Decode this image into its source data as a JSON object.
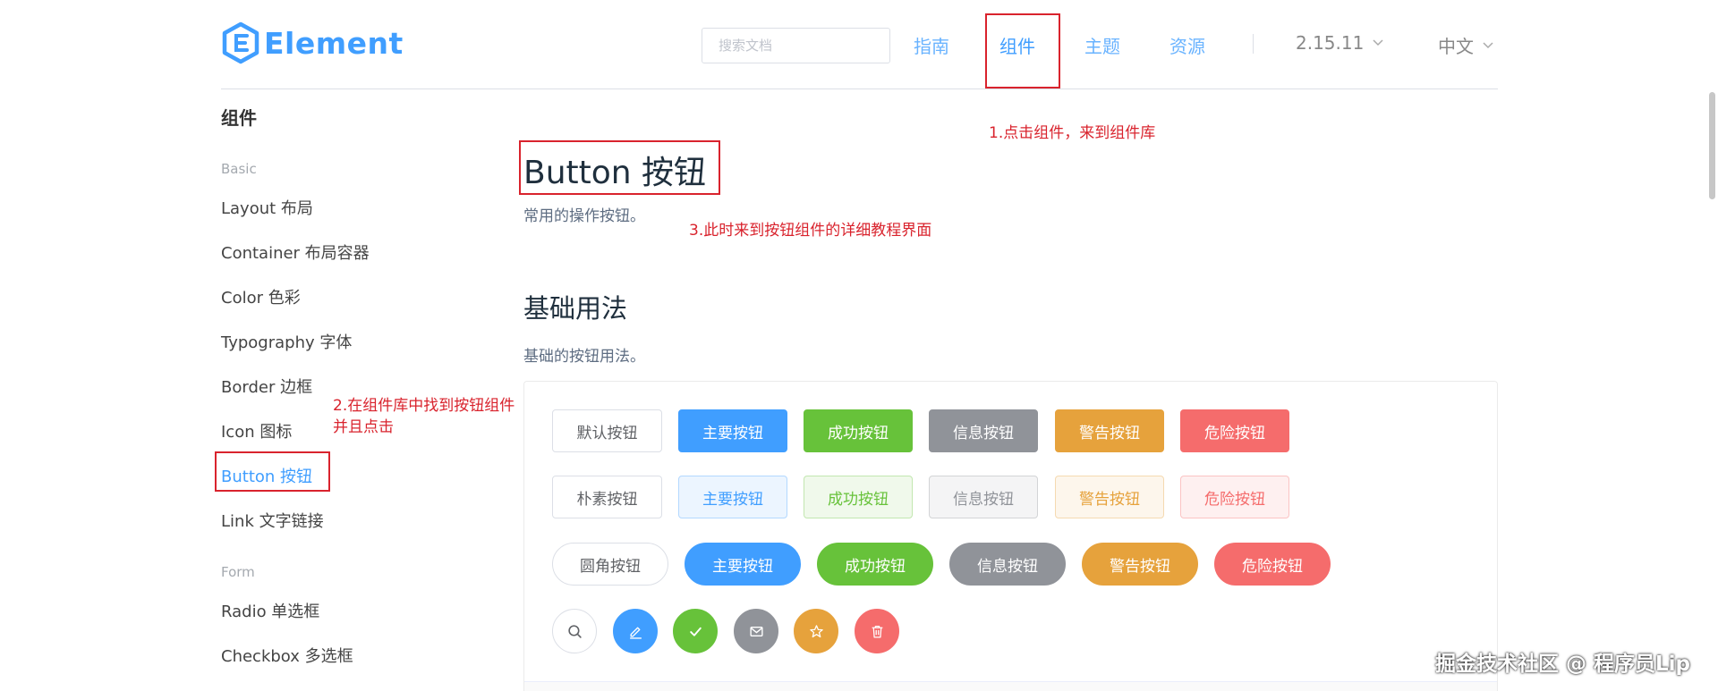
{
  "header": {
    "logo_text": "Element",
    "search_placeholder": "搜索文档",
    "nav": [
      "指南",
      "组件",
      "主题",
      "资源"
    ],
    "version": "2.15.11",
    "language": "中文"
  },
  "sidebar": {
    "title": "组件",
    "group_basic": "Basic",
    "items": [
      "Layout 布局",
      "Container 布局容器",
      "Color 色彩",
      "Typography 字体",
      "Border 边框",
      "Icon 图标",
      "Button 按钮",
      "Link 文字链接"
    ],
    "group_form": "Form",
    "form_items": [
      "Radio 单选框",
      "Checkbox 多选框"
    ]
  },
  "main": {
    "title": "Button 按钮",
    "description": "常用的操作按钮。",
    "section_title": "基础用法",
    "section_description": "基础的按钮用法。"
  },
  "buttons": {
    "default_row": [
      "默认按钮",
      "主要按钮",
      "成功按钮",
      "信息按钮",
      "警告按钮",
      "危险按钮"
    ],
    "plain_row": [
      "朴素按钮",
      "主要按钮",
      "成功按钮",
      "信息按钮",
      "警告按钮",
      "危险按钮"
    ],
    "round_row": [
      "圆角按钮",
      "主要按钮",
      "成功按钮",
      "信息按钮",
      "警告按钮",
      "危险按钮"
    ],
    "icon_row": [
      "search-icon",
      "edit-icon",
      "check-icon",
      "message-icon",
      "star-icon",
      "delete-icon"
    ]
  },
  "annotations": {
    "step1": "1.点击组件，来到组件库",
    "step2_line1": "2.在组件库中找到按钮组件",
    "step2_line2": "并且点击",
    "step3": "3.此时来到按钮组件的详细教程界面"
  },
  "watermark": "掘金技术社区 @ 程序员Lip",
  "colors": {
    "primary": "#409eff",
    "success": "#67c23a",
    "info": "#909399",
    "warning": "#e6a23c",
    "danger": "#f56c6c",
    "annotation": "#d9232d"
  }
}
